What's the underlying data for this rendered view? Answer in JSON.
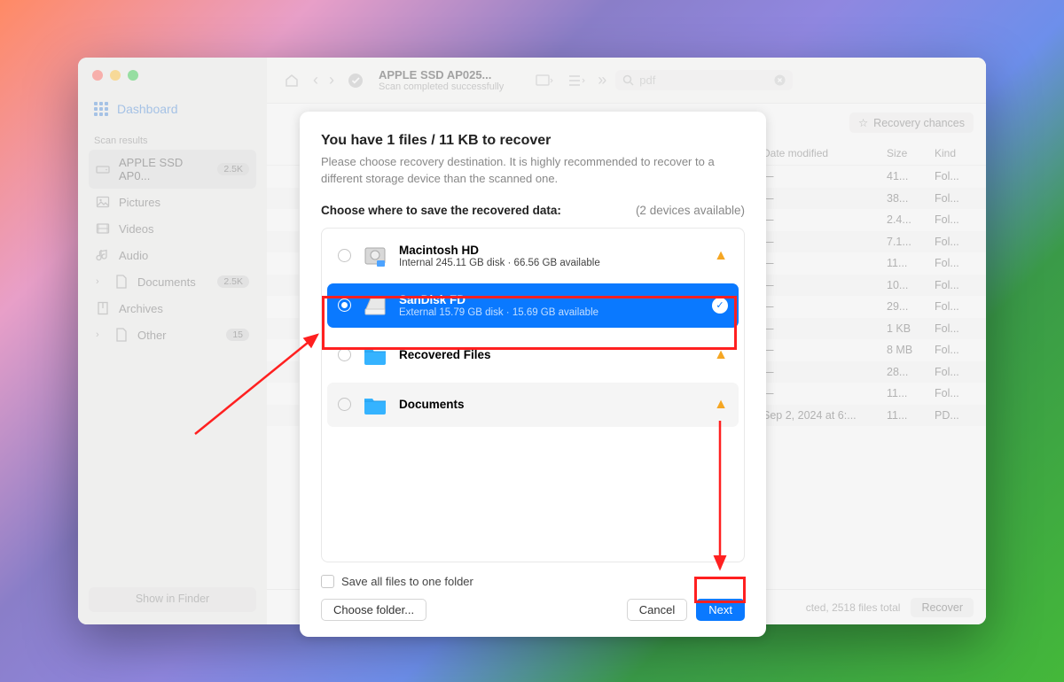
{
  "sidebar": {
    "dashboard": "Dashboard",
    "section": "Scan results",
    "items": [
      {
        "icon": "disk",
        "label": "APPLE SSD AP0...",
        "badge": "2.5K",
        "selected": true,
        "chevron": false
      },
      {
        "icon": "picture",
        "label": "Pictures",
        "chevron": false
      },
      {
        "icon": "video",
        "label": "Videos",
        "chevron": false
      },
      {
        "icon": "audio",
        "label": "Audio",
        "chevron": false
      },
      {
        "icon": "doc",
        "label": "Documents",
        "badge": "2.5K",
        "chevron": true
      },
      {
        "icon": "archive",
        "label": "Archives",
        "chevron": false
      },
      {
        "icon": "other",
        "label": "Other",
        "badge": "15",
        "chevron": true
      }
    ],
    "footer": "Show in Finder"
  },
  "toolbar": {
    "title": "APPLE SSD AP025...",
    "subtitle": "Scan completed successfully",
    "search_value": "pdf"
  },
  "header": {
    "recovery_chances": "Recovery chances",
    "date": "Date modified",
    "size": "Size",
    "kind": "Kind"
  },
  "rows": [
    {
      "date": "—",
      "size": "41...",
      "kind": "Fol..."
    },
    {
      "date": "—",
      "size": "38...",
      "kind": "Fol..."
    },
    {
      "date": "—",
      "size": "2.4...",
      "kind": "Fol..."
    },
    {
      "date": "—",
      "size": "7.1...",
      "kind": "Fol..."
    },
    {
      "date": "—",
      "size": "11...",
      "kind": "Fol..."
    },
    {
      "date": "—",
      "size": "10...",
      "kind": "Fol..."
    },
    {
      "date": "—",
      "size": "29...",
      "kind": "Fol..."
    },
    {
      "date": "—",
      "size": "1 KB",
      "kind": "Fol..."
    },
    {
      "date": "—",
      "size": "8 MB",
      "kind": "Fol..."
    },
    {
      "date": "—",
      "size": "28...",
      "kind": "Fol..."
    },
    {
      "date": "—",
      "size": "11...",
      "kind": "Fol..."
    },
    {
      "date": "Sep 2, 2024 at 6:...",
      "size": "11...",
      "kind": "PD..."
    }
  ],
  "footer": {
    "status": "cted, 2518 files total",
    "recover": "Recover"
  },
  "modal": {
    "title": "You have 1 files / 11 KB to recover",
    "subtitle": "Please choose recovery destination. It is highly recommended to recover to a different storage device than the scanned one.",
    "choose_label": "Choose where to save the recovered data:",
    "devices_avail": "(2 devices available)",
    "devices": [
      {
        "name": "Macintosh HD",
        "sub": "Internal 245.11 GB disk · 66.56 GB available",
        "selected": false,
        "warn": true,
        "icon": "hdd"
      },
      {
        "name": "SanDisk FD",
        "sub": "External 15.79 GB disk · 15.69 GB available",
        "selected": true,
        "warn": false,
        "icon": "ext"
      },
      {
        "name": "Recovered Files",
        "sub": "",
        "selected": false,
        "warn": true,
        "icon": "folder"
      },
      {
        "name": "Documents",
        "sub": "",
        "selected": false,
        "warn": true,
        "icon": "folder"
      }
    ],
    "save_all": "Save all files to one folder",
    "choose_folder": "Choose folder...",
    "cancel": "Cancel",
    "next": "Next"
  }
}
